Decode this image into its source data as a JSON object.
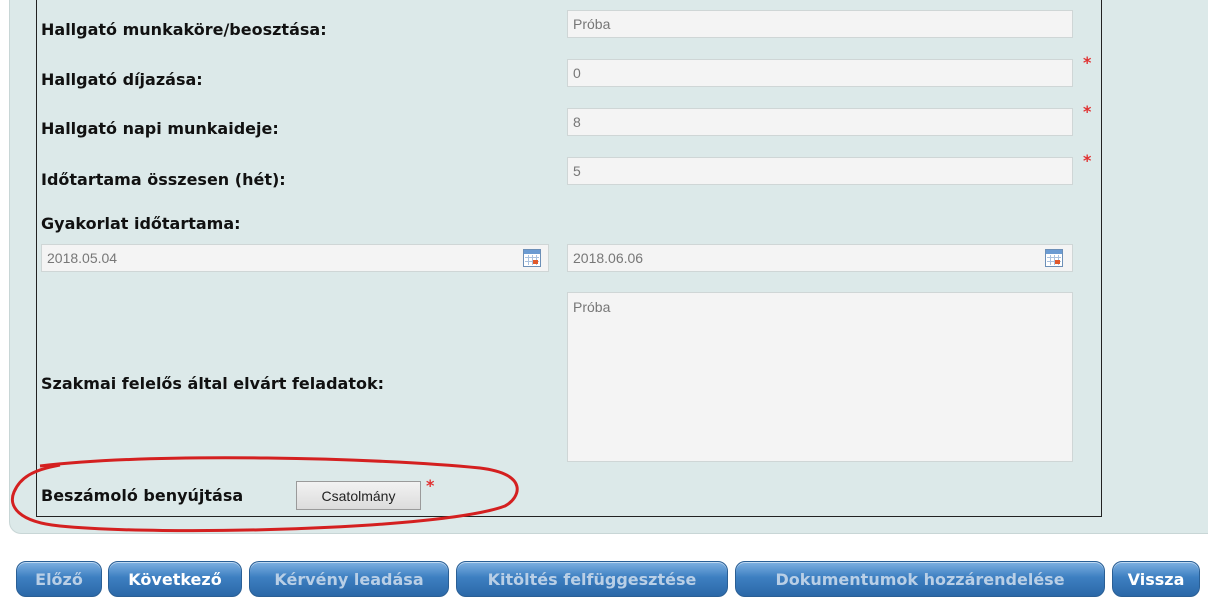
{
  "form": {
    "job_title": {
      "label": "Hallgató munkaköre/beosztása:",
      "value": "Próba"
    },
    "pay": {
      "label": "Hallgató díjazása:",
      "value": "0",
      "required": "*"
    },
    "daily_hours": {
      "label": "Hallgató napi munkaideje:",
      "value": "8",
      "required": "*"
    },
    "duration_weeks": {
      "label": "Időtartama összesen (hét):",
      "value": "5",
      "required": "*"
    },
    "practice_period": {
      "label": "Gyakorlat időtartama:",
      "start_date": "2018.05.04",
      "end_date": "2018.06.06"
    },
    "tasks": {
      "label": "Szakmai felelős által elvárt feladatok:",
      "value": "Próba"
    },
    "report": {
      "label": "Beszámoló benyújtása",
      "button": "Csatolmány",
      "required": "*"
    }
  },
  "buttons": {
    "prev": "Előző",
    "next": "Következő",
    "submit": "Kérvény leadása",
    "suspend": "Kitöltés felfüggesztése",
    "assign_docs": "Dokumentumok hozzárendelése",
    "back": "Vissza"
  },
  "colors": {
    "panel_bg": "#dce9e9",
    "required": "#e03030",
    "highlight_ellipse": "#d42020",
    "button_blue": "#3d7fc1"
  },
  "icons": {
    "calendar": "calendar-icon"
  }
}
